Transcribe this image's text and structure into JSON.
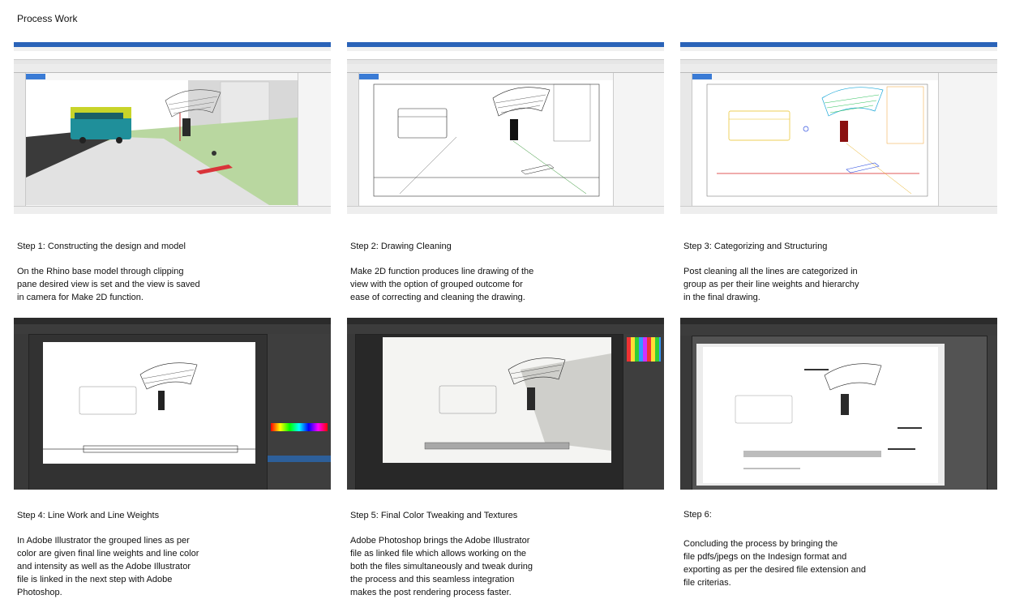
{
  "page_title": "Process Work",
  "steps": [
    {
      "id": "1",
      "heading": "Step 1: Constructing the design and model",
      "body": "On the Rhino base model through clipping\npane desired view is set and the view is saved\nin camera for Make 2D function.",
      "app": "Rhino"
    },
    {
      "id": "2",
      "heading": "Step 2: Drawing Cleaning",
      "body": "Make 2D function produces line drawing of the\nview with the option of grouped outcome for\nease of correcting and cleaning the drawing.",
      "app": "Rhino"
    },
    {
      "id": "3",
      "heading": "Step 3: Categorizing and Structuring",
      "body": "Post cleaning all the lines are categorized in\ngroup as per their line weights and hierarchy\nin the final drawing.",
      "app": "Rhino"
    },
    {
      "id": "4",
      "heading": "Step 4: Line Work and Line Weights",
      "body": "In Adobe Illustrator the grouped lines as per\ncolor are given final line weights and line color\nand intensity as well as the Adobe Illustrator\nfile is linked in the next step with Adobe\nPhotoshop.",
      "app": "Illustrator"
    },
    {
      "id": "5",
      "heading": "Step 5: Final Color Tweaking and Textures",
      "body": "Adobe Photoshop brings the Adobe Illustrator\nfile as linked file which allows working on the\nboth the files simultaneously and tweak during\nthe process and this seamless integration\nmakes the post rendering process faster.",
      "app": "Photoshop"
    },
    {
      "id": "6",
      "heading": "Step 6:",
      "body": "Concluding the process by bringing the\nfile pdfs/jpegs on the Indesign format and\nexporting as per the desired file extension and\nfile criterias.",
      "app": "InDesign"
    }
  ],
  "colors": {
    "rhino_blue": "#2a63b8",
    "bus_yellow": "#c8d42a",
    "bus_teal": "#1f8f9a",
    "bench_red": "#d9343a",
    "ground_green": "#b9d7a0",
    "dark_ui": "#323232"
  }
}
